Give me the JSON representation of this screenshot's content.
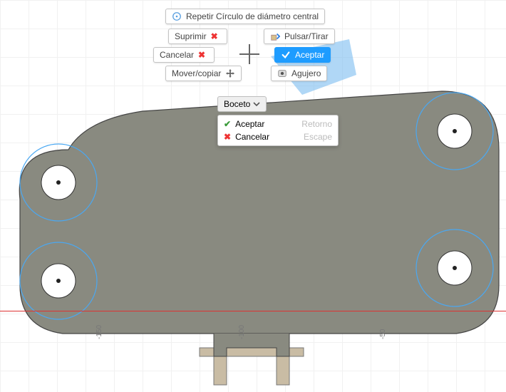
{
  "marking_menu": {
    "top": {
      "label": "Repetir Círculo de diámetro central"
    },
    "left": [
      {
        "label": "Suprimir"
      },
      {
        "label": "Cancelar"
      },
      {
        "label": "Mover/copiar"
      }
    ],
    "right": [
      {
        "label": "Pulsar/Tirar"
      },
      {
        "label": "Aceptar"
      },
      {
        "label": "Agujero"
      }
    ]
  },
  "dropdown": {
    "selected": "Boceto",
    "items": [
      {
        "label": "Aceptar",
        "shortcut": "Retorno"
      },
      {
        "label": "Cancelar",
        "shortcut": "Escape"
      }
    ]
  },
  "axis_ticks": [
    "-150",
    "-100",
    "-50"
  ],
  "colors": {
    "accent": "#1e9cff",
    "sketch": "#4aa8f2",
    "part": "#898a80"
  }
}
